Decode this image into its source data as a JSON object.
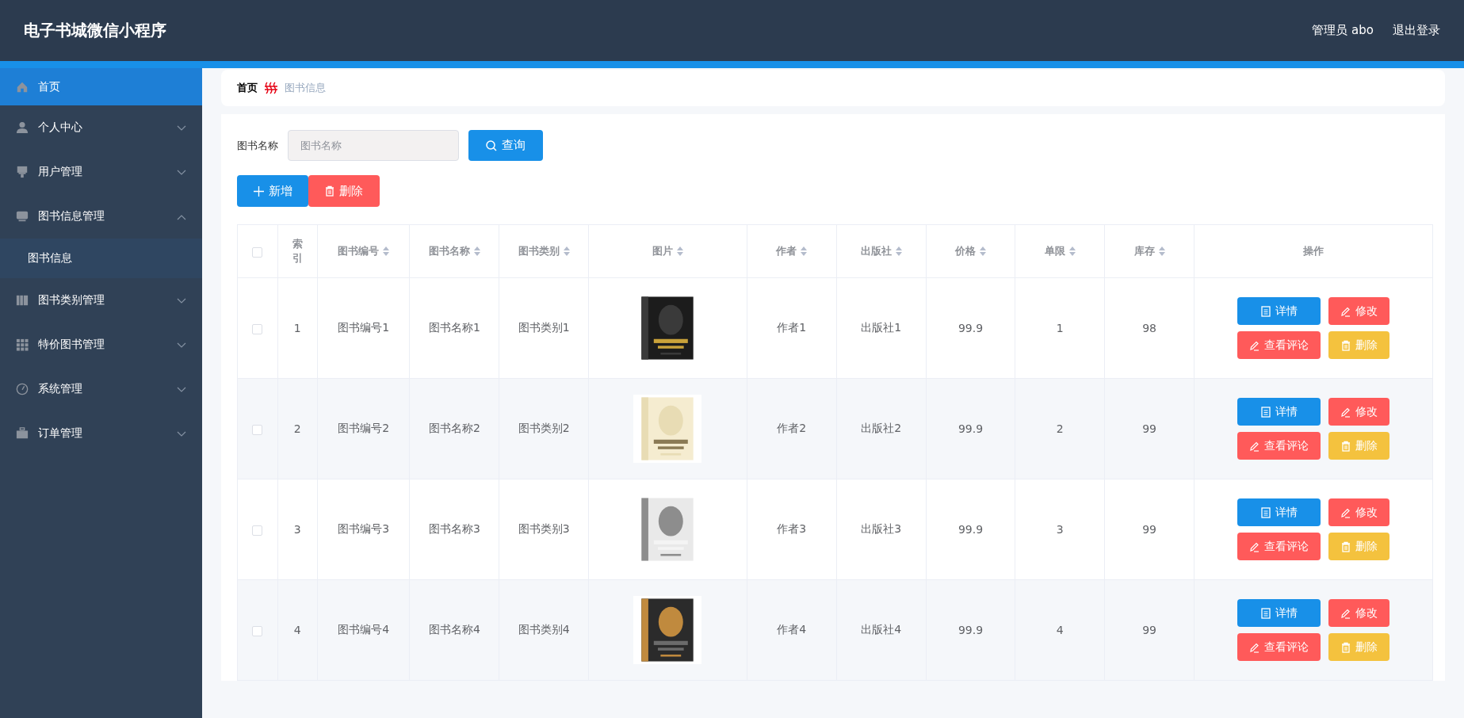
{
  "header": {
    "title": "电子书城微信小程序",
    "user": "管理员 abo",
    "logout": "退出登录"
  },
  "sidebar": {
    "items": [
      {
        "label": "首页",
        "selected": true
      },
      {
        "label": "个人中心",
        "selected": false,
        "expanded": false
      },
      {
        "label": "用户管理",
        "selected": false,
        "expanded": false
      },
      {
        "label": "图书信息管理",
        "selected": false,
        "expanded": true,
        "children": [
          {
            "label": "图书信息",
            "selected": false
          }
        ]
      },
      {
        "label": "图书类别管理",
        "selected": false,
        "expanded": false
      },
      {
        "label": "特价图书管理",
        "selected": false,
        "expanded": false
      },
      {
        "label": "系统管理",
        "selected": false,
        "expanded": false
      },
      {
        "label": "订单管理",
        "selected": false,
        "expanded": false
      }
    ]
  },
  "breadcrumb": [
    "首页",
    "图书信息"
  ],
  "search": {
    "label": "图书名称",
    "placeholder": "图书名称",
    "button": "查询"
  },
  "toolbar": {
    "add": "新增",
    "delete": "删除"
  },
  "table": {
    "all_checked": false,
    "columns": [
      {
        "label": "索引",
        "sortable": false
      },
      {
        "label": "图书编号",
        "sortable": true
      },
      {
        "label": "图书名称",
        "sortable": true
      },
      {
        "label": "图书类别",
        "sortable": true
      },
      {
        "label": "图片",
        "sortable": true
      },
      {
        "label": "作者",
        "sortable": true
      },
      {
        "label": "出版社",
        "sortable": true
      },
      {
        "label": "价格",
        "sortable": true
      },
      {
        "label": "单限",
        "sortable": true
      },
      {
        "label": "库存",
        "sortable": true
      },
      {
        "label": "操作",
        "sortable": false
      }
    ],
    "rows": [
      {
        "checked": false,
        "cells": [
          "1",
          "图书编号1",
          "图书名称1",
          "图书类别1",
          {
            "kind": "picture"
          },
          "作者1",
          "出版社1",
          "99.9",
          "1",
          "98",
          {
            "kind": "actions",
            "buttons": [
              "详情",
              "修改",
              "查看评论",
              "删除"
            ]
          }
        ]
      },
      {
        "checked": false,
        "cells": [
          "2",
          "图书编号2",
          "图书名称2",
          "图书类别2",
          {
            "kind": "picture"
          },
          "作者2",
          "出版社2",
          "99.9",
          "2",
          "99",
          {
            "kind": "actions",
            "buttons": [
              "详情",
              "修改",
              "查看评论",
              "删除"
            ]
          }
        ]
      },
      {
        "checked": false,
        "cells": [
          "3",
          "图书编号3",
          "图书名称3",
          "图书类别3",
          {
            "kind": "picture"
          },
          "作者3",
          "出版社3",
          "99.9",
          "3",
          "99",
          {
            "kind": "actions",
            "buttons": [
              "详情",
              "修改",
              "查看评论",
              "删除"
            ]
          }
        ]
      },
      {
        "checked": false,
        "cells": [
          "4",
          "图书编号4",
          "图书名称4",
          "图书类别4",
          {
            "kind": "picture"
          },
          "作者4",
          "出版社4",
          "99.9",
          "4",
          "99",
          {
            "kind": "actions",
            "buttons": [
              "详情",
              "修改",
              "查看评论",
              "删除"
            ]
          }
        ]
      }
    ]
  }
}
